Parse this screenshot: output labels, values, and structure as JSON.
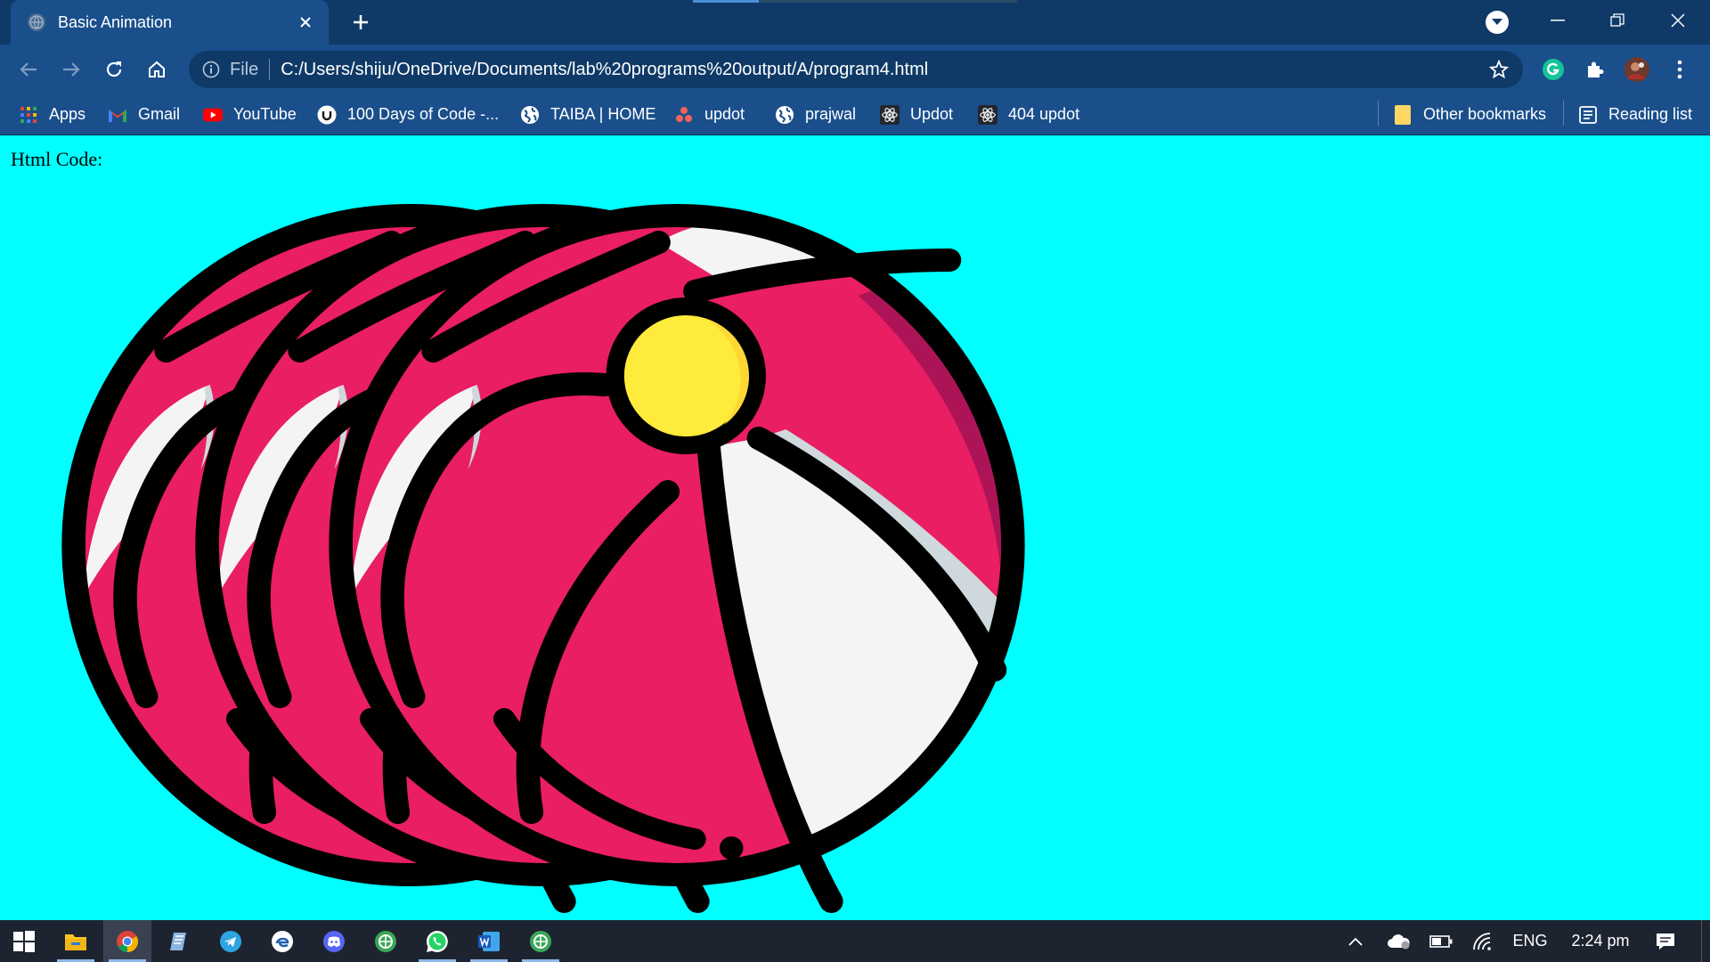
{
  "browser": {
    "tab_title": "Basic Animation",
    "address_prefix": "File",
    "url": "C:/Users/shiju/OneDrive/Documents/lab%20programs%20output/A/program4.html",
    "bookmarks": [
      {
        "label": "Apps",
        "icon": "apps-grid-icon"
      },
      {
        "label": "Gmail",
        "icon": "gmail-icon"
      },
      {
        "label": "YouTube",
        "icon": "youtube-icon"
      },
      {
        "label": "100 Days of Code -...",
        "icon": "udemy-icon"
      },
      {
        "label": "TAIBA | HOME",
        "icon": "globe-icon"
      },
      {
        "label": "updot",
        "icon": "updot-icon"
      },
      {
        "label": "prajwal",
        "icon": "globe-icon"
      },
      {
        "label": "Updot",
        "icon": "react-icon"
      },
      {
        "label": "404 updot",
        "icon": "react-icon"
      }
    ],
    "other_bookmarks": "Other bookmarks",
    "reading_list": "Reading list",
    "colors": {
      "frame": "#0f3a67",
      "toolbar": "#1a4f8c"
    }
  },
  "page": {
    "heading": "Html Code:",
    "background": "#00ffff",
    "ball_colors": {
      "pink": "#e91e63",
      "dark_pink": "#ad1457",
      "white": "#f4f4f4",
      "shadow": "#cfd8dc",
      "yellow": "#ffeb3b",
      "yellow_dark": "#fdd835",
      "outline": "#000000"
    }
  },
  "taskbar": {
    "apps": [
      "windows-start-icon",
      "file-explorer-icon",
      "chrome-icon",
      "notepad-icon",
      "telegram-icon",
      "edge-icon",
      "discord-icon",
      "app-green-icon",
      "whatsapp-icon",
      "word-icon",
      "app-green-icon"
    ],
    "language": "ENG",
    "time": "2:24 pm"
  }
}
